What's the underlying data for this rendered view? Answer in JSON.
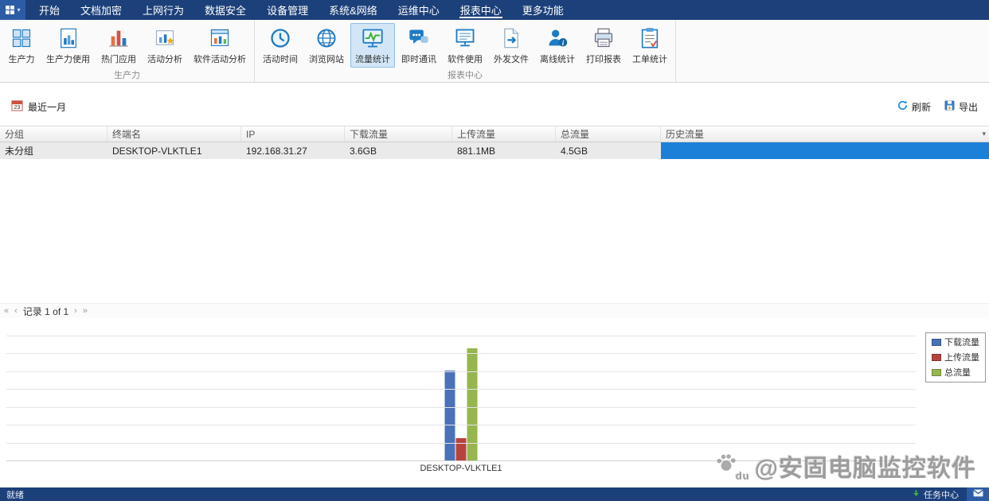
{
  "menu": {
    "items": [
      {
        "label": "开始",
        "active": false
      },
      {
        "label": "文档加密",
        "active": false
      },
      {
        "label": "上网行为",
        "active": false
      },
      {
        "label": "数据安全",
        "active": false
      },
      {
        "label": "设备管理",
        "active": false
      },
      {
        "label": "系统&网络",
        "active": false
      },
      {
        "label": "运维中心",
        "active": false
      },
      {
        "label": "报表中心",
        "active": true
      },
      {
        "label": "更多功能",
        "active": false
      }
    ]
  },
  "ribbon": {
    "groups": [
      {
        "label": "生产力",
        "items": [
          {
            "label": "生产力",
            "icon": "productivity-grid-icon",
            "active": false
          },
          {
            "label": "生产力使用",
            "icon": "productivity-usage-icon",
            "active": false
          },
          {
            "label": "热门应用",
            "icon": "hot-apps-chart-icon",
            "active": false
          },
          {
            "label": "活动分析",
            "icon": "activity-analysis-star-icon",
            "active": false
          },
          {
            "label": "软件活动分析",
            "icon": "software-activity-chart-icon",
            "active": false
          }
        ]
      },
      {
        "label": "报表中心",
        "items": [
          {
            "label": "活动时间",
            "icon": "clock-icon",
            "active": false
          },
          {
            "label": "浏览网站",
            "icon": "globe-icon",
            "active": false
          },
          {
            "label": "流量统计",
            "icon": "traffic-monitor-icon",
            "active": true
          },
          {
            "label": "即时通讯",
            "icon": "chat-icon",
            "active": false
          },
          {
            "label": "软件使用",
            "icon": "software-usage-monitor-icon",
            "active": false
          },
          {
            "label": "外发文件",
            "icon": "outgoing-file-icon",
            "active": false
          },
          {
            "label": "离线统计",
            "icon": "offline-user-icon",
            "active": false
          },
          {
            "label": "打印报表",
            "icon": "printer-icon",
            "active": false
          },
          {
            "label": "工单统计",
            "icon": "worksheet-icon",
            "active": false
          }
        ]
      }
    ]
  },
  "toolbar": {
    "date_filter_label": "最近一月",
    "refresh_label": "刷新",
    "export_label": "导出"
  },
  "table": {
    "columns": [
      {
        "label": "分组"
      },
      {
        "label": "终端名"
      },
      {
        "label": "IP"
      },
      {
        "label": "下载流量"
      },
      {
        "label": "上传流量"
      },
      {
        "label": "总流量"
      },
      {
        "label": "历史流量"
      }
    ],
    "rows": [
      {
        "cells": [
          "未分组",
          "DESKTOP-VLKTLE1",
          "192.168.31.27",
          "3.6GB",
          "881.1MB",
          "4.5GB",
          ""
        ],
        "history_bar": true,
        "selected": true
      }
    ],
    "history_bar_color": "#1d80d8"
  },
  "pagination": {
    "controls_left": [
      {
        "glyph": "«",
        "name": "first-page-button"
      },
      {
        "glyph": "‹",
        "name": "prev-page-button"
      }
    ],
    "label": "记录 1 of 1",
    "controls_right": [
      {
        "glyph": "›",
        "name": "next-page-button"
      },
      {
        "glyph": "»",
        "name": "last-page-button"
      }
    ]
  },
  "chart_data": {
    "type": "bar",
    "title": "",
    "xlabel": "",
    "ylabel": "",
    "unit": "GB",
    "categories": [
      "DESKTOP-VLKTLE1"
    ],
    "series": [
      {
        "name": "下载流量",
        "values": [
          3.6
        ],
        "color": "#4a72b8"
      },
      {
        "name": "上传流量",
        "values": [
          0.881
        ],
        "color": "#b8433e"
      },
      {
        "name": "总流量",
        "values": [
          4.5
        ],
        "color": "#96b64e"
      }
    ],
    "ylim": [
      0,
      5
    ],
    "grid": true,
    "legend_position": "top-right"
  },
  "watermark": {
    "badge": "du",
    "text": "@安固电脑监控软件"
  },
  "statusbar": {
    "left": "就绪",
    "task_center": "任务中心"
  },
  "icons": {
    "column_menu": "▾",
    "app_menu_caret": "▾"
  }
}
